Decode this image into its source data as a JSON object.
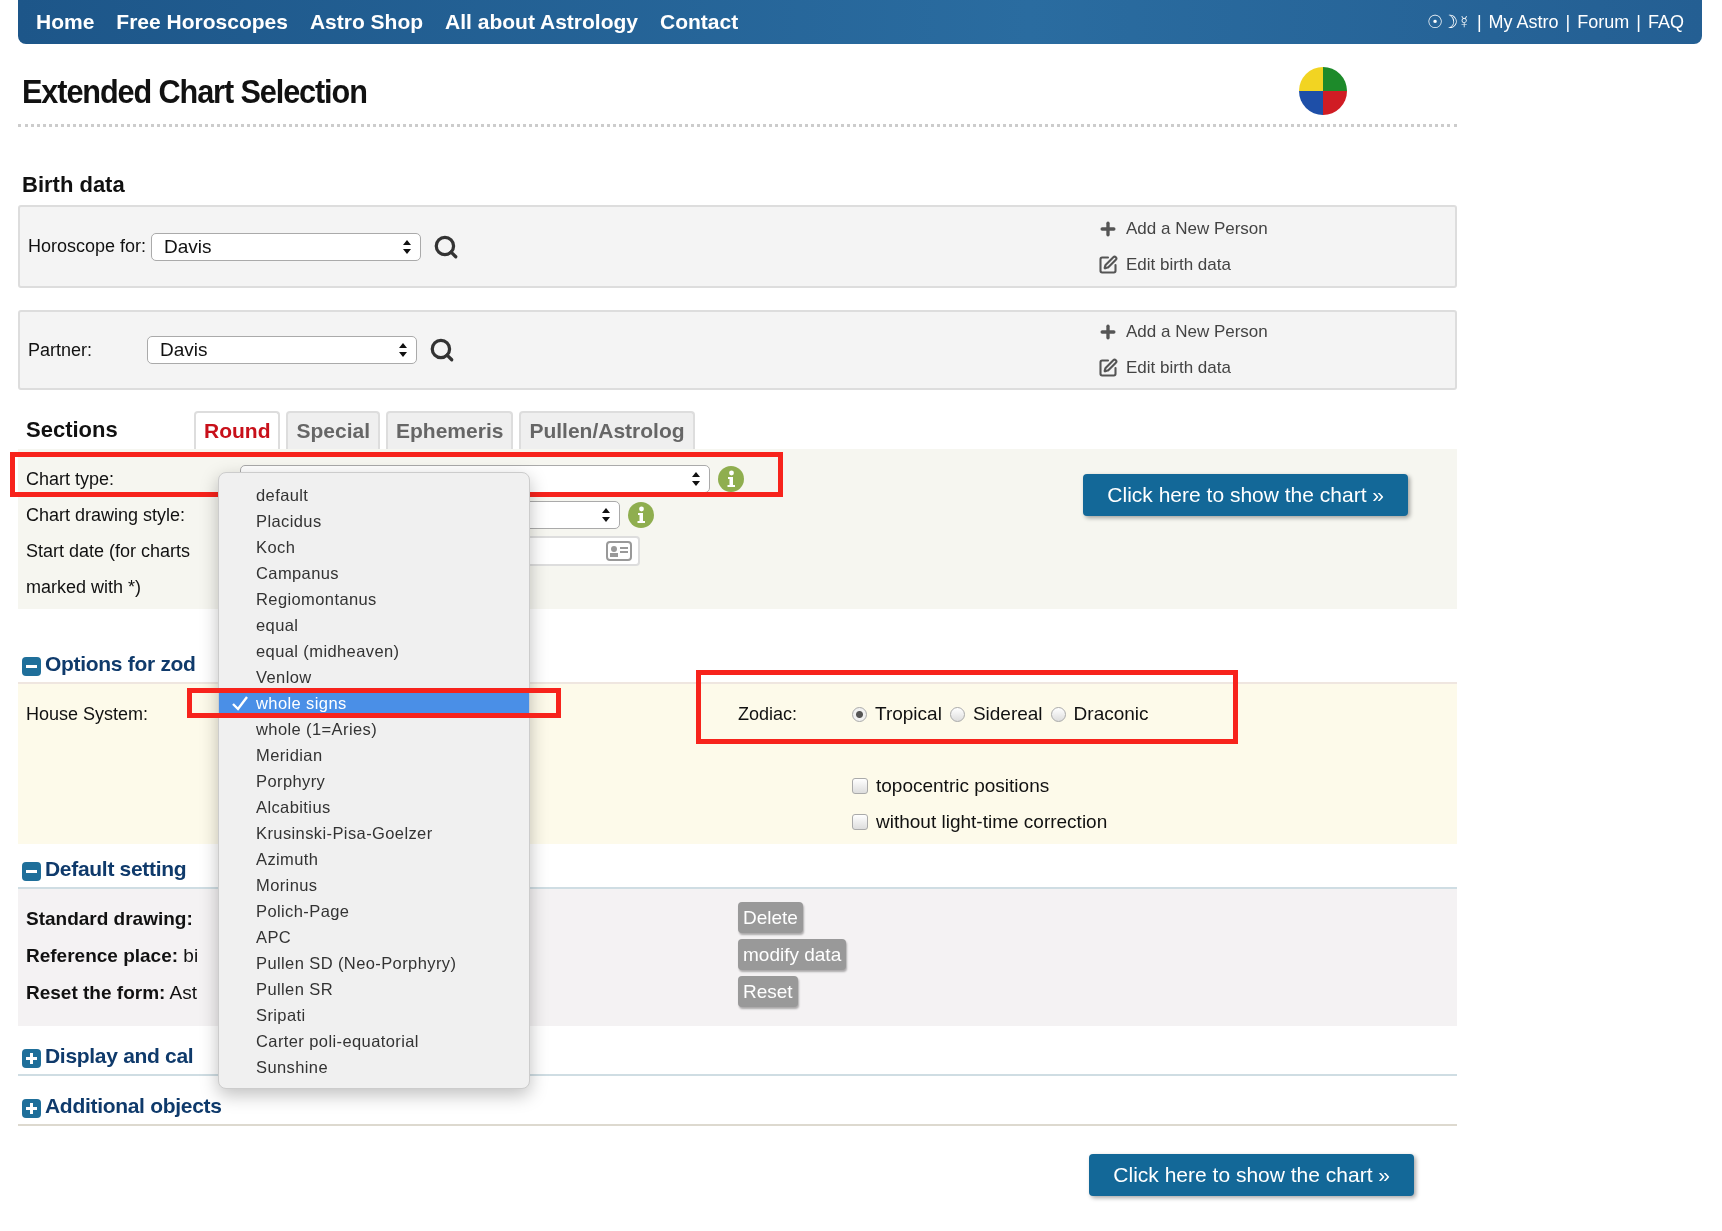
{
  "nav": {
    "links": [
      "Home",
      "Free Horoscopes",
      "Astro Shop",
      "All about Astrology",
      "Contact"
    ],
    "symbols": "☉☽☿",
    "separator": "|",
    "right_links": [
      "My Astro",
      "Forum",
      "FAQ"
    ]
  },
  "page_title": "Extended Chart Selection",
  "birth_data": {
    "heading": "Birth data",
    "people": [
      {
        "label": "Horoscope for:",
        "value": "Davis",
        "actions": [
          "Add a New Person",
          "Edit birth data"
        ]
      },
      {
        "label": "Partner:",
        "value": "Davis",
        "actions": [
          "Add a New Person",
          "Edit birth data"
        ]
      }
    ]
  },
  "sections": {
    "heading": "Sections",
    "tabs": [
      {
        "label": "Round",
        "selected": true
      },
      {
        "label": "Special",
        "selected": false
      },
      {
        "label": "Ephemeris",
        "selected": false
      },
      {
        "label": "Pullen/Astrolog",
        "selected": false
      }
    ]
  },
  "round": {
    "fields": [
      {
        "label": "Chart type:",
        "kind": "select"
      },
      {
        "label": "Chart drawing style:",
        "kind": "select"
      },
      {
        "label": "Start date (for charts marked with *)",
        "kind": "date"
      }
    ],
    "show_button": "Click here to show the chart »"
  },
  "options_zodiac": {
    "heading": "Options for zod",
    "expanded": true,
    "house_label": "House System:",
    "house_options": [
      {
        "label": "default",
        "selected": false
      },
      {
        "label": "Placidus",
        "selected": false
      },
      {
        "label": "Koch",
        "selected": false
      },
      {
        "label": "Campanus",
        "selected": false
      },
      {
        "label": "Regiomontanus",
        "selected": false
      },
      {
        "label": "equal",
        "selected": false
      },
      {
        "label": "equal (midheaven)",
        "selected": false
      },
      {
        "label": "Venlow",
        "selected": false
      },
      {
        "label": "whole signs",
        "selected": true
      },
      {
        "label": "whole (1=Aries)",
        "selected": false
      },
      {
        "label": "Meridian",
        "selected": false
      },
      {
        "label": "Porphyry",
        "selected": false
      },
      {
        "label": "Alcabitius",
        "selected": false
      },
      {
        "label": "Krusinski-Pisa-Goelzer",
        "selected": false
      },
      {
        "label": "Azimuth",
        "selected": false
      },
      {
        "label": "Morinus",
        "selected": false
      },
      {
        "label": "Polich-Page",
        "selected": false
      },
      {
        "label": "APC",
        "selected": false
      },
      {
        "label": "Pullen SD (Neo-Porphyry)",
        "selected": false
      },
      {
        "label": "Pullen SR",
        "selected": false
      },
      {
        "label": "Sripati",
        "selected": false
      },
      {
        "label": "Carter poli-equatorial",
        "selected": false
      },
      {
        "label": "Sunshine",
        "selected": false
      }
    ],
    "zodiac_label": "Zodiac:",
    "zodiac_options": [
      {
        "label": "Tropical",
        "selected": true
      },
      {
        "label": "Sidereal",
        "selected": false
      },
      {
        "label": "Draconic",
        "selected": false
      }
    ],
    "checkboxes": [
      {
        "label": "topocentric positions",
        "checked": false
      },
      {
        "label": "without light-time correction",
        "checked": false
      }
    ]
  },
  "default_settings": {
    "heading": "Default setting",
    "expanded": true,
    "rows": [
      {
        "label": "Standard drawing:",
        "button": "Delete"
      },
      {
        "label": "Reference place:",
        "value": "bi",
        "button": "modify data"
      },
      {
        "label": "Reset the form:",
        "value": "Ast",
        "button": "Reset"
      }
    ]
  },
  "collapsed_sections": [
    {
      "heading": "Display and cal",
      "expanded": false
    },
    {
      "heading": "Additional objects",
      "expanded": false
    }
  ],
  "bottom_button": "Click here to show the chart »"
}
